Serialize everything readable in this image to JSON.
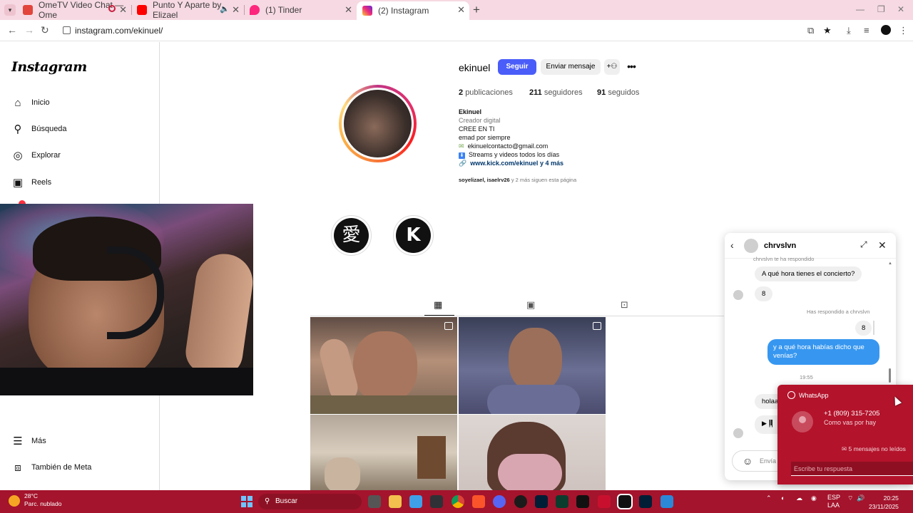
{
  "browser": {
    "tabs": [
      {
        "title": "OmeTV Video Chat — Ome",
        "favicon_color": "#e2453b"
      },
      {
        "title": "Punto Y Aparte by Elizael",
        "favicon_color": "#ff0000"
      },
      {
        "title": "(1) Tinder",
        "favicon_color": "#fd267d"
      },
      {
        "title": "(2) Instagram",
        "favicon_color": "#d62976"
      }
    ],
    "url": "instagram.com/ekinuel/"
  },
  "sidebar": {
    "logo": "Instagram",
    "items": [
      {
        "label": "Inicio",
        "icon": "home-icon"
      },
      {
        "label": "Búsqueda",
        "icon": "search-icon"
      },
      {
        "label": "Explorar",
        "icon": "compass-icon"
      },
      {
        "label": "Reels",
        "icon": "reels-icon"
      },
      {
        "label": "Más",
        "icon": "menu-icon"
      },
      {
        "label": "También de Meta",
        "icon": "meta-icon"
      }
    ]
  },
  "profile": {
    "username": "ekinuel",
    "follow_label": "Seguir",
    "message_label": "Enviar mensaje",
    "stats": {
      "posts_count": "2",
      "posts_label": "publicaciones",
      "followers_count": "211",
      "followers_label": "seguidores",
      "following_count": "91",
      "following_label": "seguidos"
    },
    "bio": {
      "name": "Ekinuel",
      "category": "Creador digital",
      "line1": "CREE EN TI",
      "line2": "emad por siempre",
      "email": "ekinuelcontacto@gmail.com",
      "line4": "Streams y videos todos los días",
      "link": "www.kick.com/ekinuel y 4 más"
    },
    "followed_by": {
      "names": "soyelizael, isaelrv26",
      "rest": "y 2 más siguen esta página"
    },
    "highlights": [
      "愛",
      "K"
    ]
  },
  "dm": {
    "contact": "chrvslvn",
    "replied_to_you": "chrvslvn te ha respondido",
    "msg_in_1": "A qué hora tienes el concierto?",
    "msg_in_2": "8",
    "you_replied": "Has respondido a chrvslvn",
    "quoted": "8",
    "msg_out": "y a qué hora habías dicho que venías?",
    "time": "19:55",
    "msg_in_3": "holaaa",
    "input_placeholder": "Envía un mensaje..."
  },
  "whatsapp": {
    "app": "WhatsApp",
    "number": "+1 (809) 315-7205",
    "message": "Como vas por hay",
    "unread": "5 mensajes no leídos",
    "reply_placeholder": "Escribe tu respuesta"
  },
  "taskbar": {
    "temp": "28°C",
    "weather": "Parc. nublado",
    "search": "Buscar",
    "lang": "ESP",
    "region": "LAA",
    "time": "20:25",
    "date": "23/11/2025"
  },
  "colors": {
    "follow_button": "#4a5df9",
    "dm_bubble_out": "#3797f0",
    "whatsapp_toast": "#b3132b",
    "taskbar": "#a4142c",
    "tabbar": "#f6d9e2"
  }
}
